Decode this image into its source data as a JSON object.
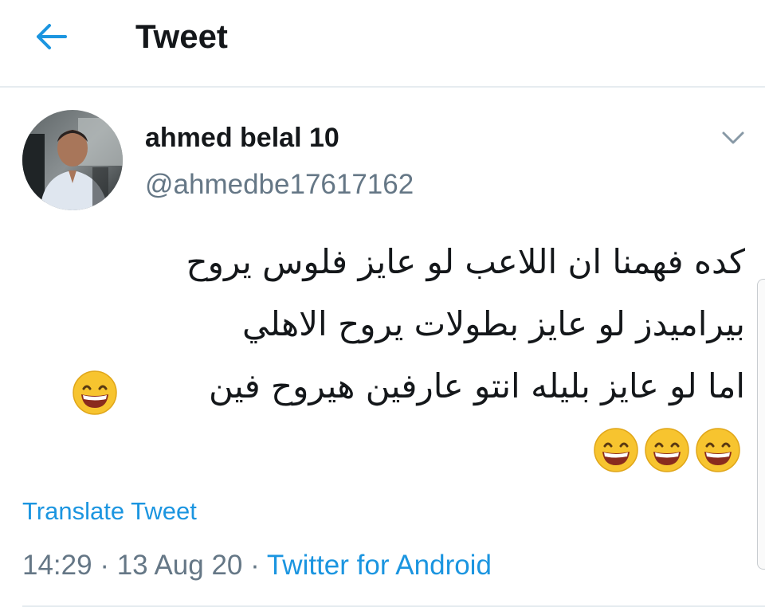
{
  "header": {
    "title": "Tweet",
    "back_icon": "arrow-left-icon",
    "accent_color": "#1b95e0"
  },
  "tweet": {
    "author": {
      "display_name": "ahmed belal 10",
      "handle": "@ahmedbe17617162"
    },
    "text_lines": [
      "كده فهمنا ان اللاعب لو عايز  فلوس  يروح",
      "بيراميدز  لو عايز بطولات   يروح الاهلي",
      "اما لو عايز بليله  انتو عارفين هيروح فين"
    ],
    "emoji": "grinning-face-with-smiling-eyes",
    "translate_label": "Translate Tweet",
    "time": "14:29",
    "date": "13 Aug 20",
    "separator": "·",
    "source": "Twitter for Android"
  }
}
